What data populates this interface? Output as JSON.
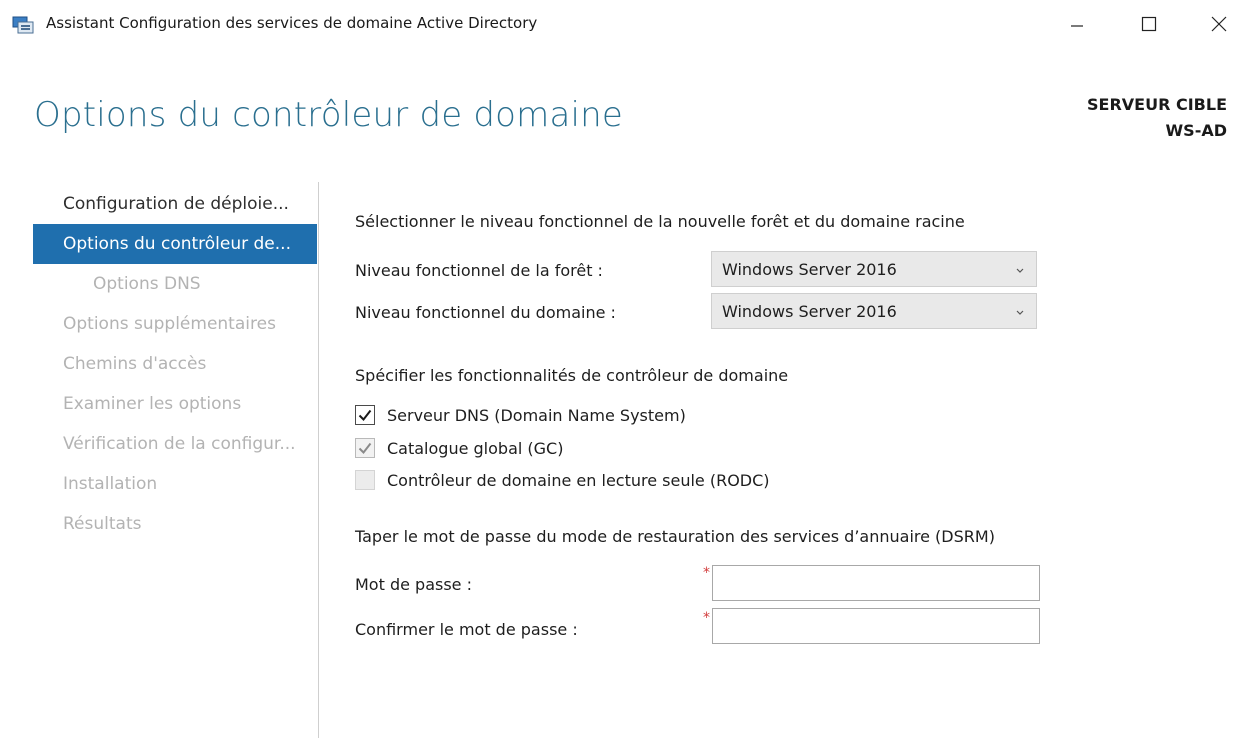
{
  "window": {
    "title": "Assistant Configuration des services de domaine Active Directory",
    "icons": {
      "app": "server-icon",
      "minimize": "minimize-icon",
      "maximize": "maximize-icon",
      "close": "close-icon"
    }
  },
  "header": {
    "page_title": "Options du contrôleur de domaine",
    "target_line1": "SERVEUR CIBLE",
    "target_line2": "WS-AD"
  },
  "nav": {
    "items": [
      {
        "label": "Configuration de déploie...",
        "state": "done"
      },
      {
        "label": "Options du contrôleur de...",
        "state": "active"
      },
      {
        "label": "Options DNS",
        "state": "disabled"
      },
      {
        "label": "Options supplémentaires",
        "state": "disabled"
      },
      {
        "label": "Chemins d'accès",
        "state": "disabled"
      },
      {
        "label": "Examiner les options",
        "state": "disabled"
      },
      {
        "label": "Vérification de la configur...",
        "state": "disabled"
      },
      {
        "label": "Installation",
        "state": "disabled"
      },
      {
        "label": "Résultats",
        "state": "disabled"
      }
    ]
  },
  "functional_level": {
    "heading": "Sélectionner le niveau fonctionnel de la nouvelle forêt et du domaine racine",
    "forest_label": "Niveau fonctionnel de la forêt :",
    "forest_value": "Windows Server 2016",
    "domain_label": "Niveau fonctionnel du domaine :",
    "domain_value": "Windows Server 2016"
  },
  "capabilities": {
    "heading": "Spécifier les fonctionnalités de contrôleur de domaine",
    "dns_label": "Serveur DNS (Domain Name System)",
    "dns_checked": true,
    "gc_label": "Catalogue global (GC)",
    "gc_checked": true,
    "rodc_label": "Contrôleur de domaine en lecture seule (RODC)",
    "rodc_checked": false
  },
  "dsrm": {
    "heading": "Taper le mot de passe du mode de restauration des services d’annuaire (DSRM)",
    "password_label": "Mot de passe :",
    "password_value": "",
    "confirm_label": "Confirmer le mot de passe :",
    "confirm_value": "",
    "required_mark": "*"
  },
  "colors": {
    "accent": "#1f6fae",
    "title": "#2a6f8f",
    "disabled_text": "#b3b3b3",
    "required": "#d23c3c"
  }
}
